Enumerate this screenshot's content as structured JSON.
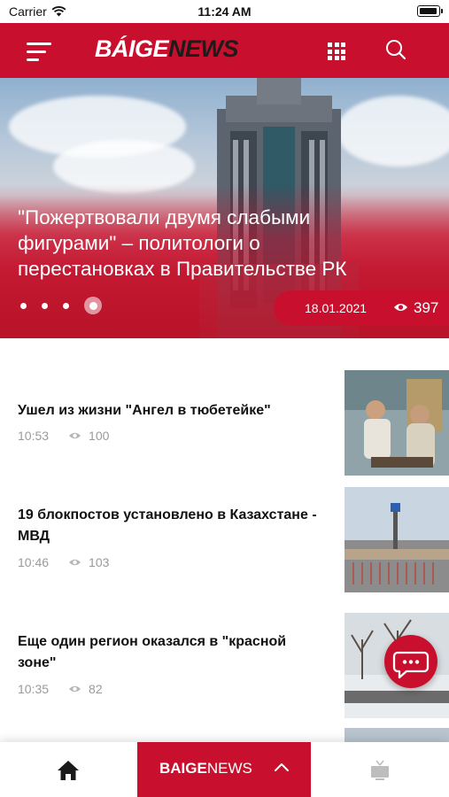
{
  "status_bar": {
    "carrier": "Carrier",
    "time": "11:24 AM"
  },
  "header": {
    "logo_part1": "BÁIGE",
    "logo_part2": "NEWS",
    "menu_icon": "hamburger-menu-icon",
    "grid_icon": "grid-menu-icon",
    "search_icon": "search-icon"
  },
  "hero": {
    "title": "\"Пожертвовали двумя слабыми фигурами\" – политологи о перестановках в Правительстве РК",
    "date": "18.01.2021",
    "views": "397",
    "slides_count": 4,
    "active_slide": 4
  },
  "news": [
    {
      "title": "Ушел из жизни \"Ангел в тюбетейке\"",
      "time": "10:53",
      "views": "100"
    },
    {
      "title": "19 блокпостов установлено в Казахстане - МВД",
      "time": "10:46",
      "views": "103"
    },
    {
      "title": "Еще один регион оказался в \"красной зоне\"",
      "time": "10:35",
      "views": "82"
    }
  ],
  "bottom_bar": {
    "brand_part1": "BAIGE",
    "brand_part2": "NEWS",
    "home_icon": "home-icon",
    "chevron_icon": "chevron-up-icon",
    "tv_icon": "tv-icon"
  },
  "colors": {
    "brand_red": "#c8102e",
    "meta_gray": "#9a9a9a"
  }
}
